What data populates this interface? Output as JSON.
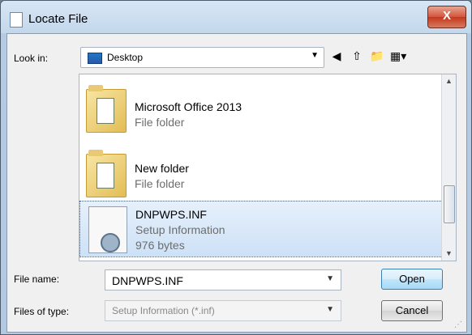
{
  "window": {
    "title": "Locate File",
    "close_label": "X"
  },
  "toolbar": {
    "look_in_label": "Look in:",
    "look_in_value": "Desktop",
    "icons": [
      "back-icon",
      "up-folder-icon",
      "new-folder-icon",
      "view-menu-icon"
    ]
  },
  "files": [
    {
      "name": "Microsoft Office 2013",
      "type": "File folder"
    },
    {
      "name": "New folder",
      "type": "File folder"
    },
    {
      "name": "DNPWPS.INF",
      "type": "Setup Information",
      "size": "976 bytes",
      "selected": true
    }
  ],
  "form": {
    "file_name_label": "File name:",
    "file_name_value": "DNPWPS.INF",
    "files_of_type_label": "Files of type:",
    "files_of_type_value": "Setup Information (*.inf)"
  },
  "buttons": {
    "open": "Open",
    "cancel": "Cancel"
  }
}
